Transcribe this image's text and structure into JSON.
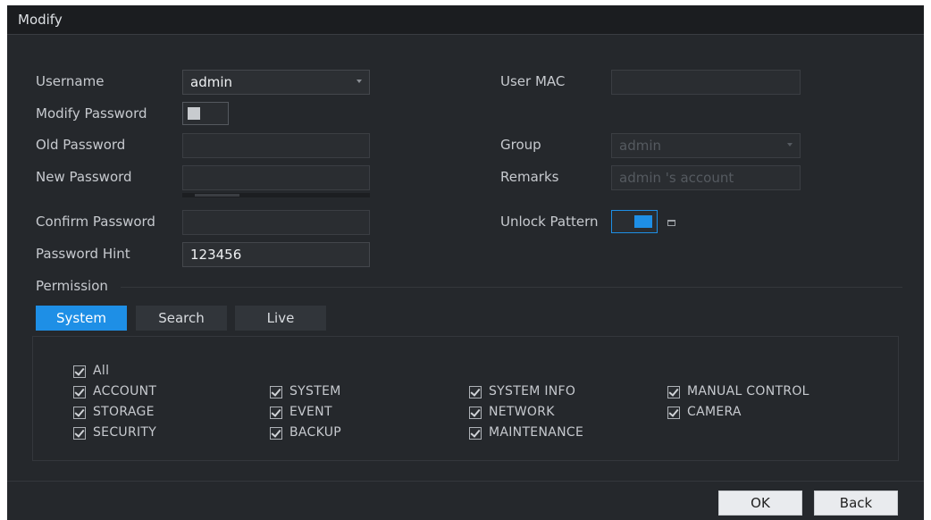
{
  "dialog": {
    "title": "Modify"
  },
  "form": {
    "username": {
      "label": "Username",
      "value": "admin"
    },
    "modify_password": {
      "label": "Modify Password",
      "on": false
    },
    "old_password": {
      "label": "Old Password",
      "value": ""
    },
    "new_password": {
      "label": "New Password",
      "value": ""
    },
    "confirm_password": {
      "label": "Confirm Password",
      "value": ""
    },
    "password_hint": {
      "label": "Password Hint",
      "value": "123456"
    },
    "user_mac": {
      "label": "User MAC",
      "value": ""
    },
    "group": {
      "label": "Group",
      "value": "admin"
    },
    "remarks": {
      "label": "Remarks",
      "value": "admin 's account"
    },
    "unlock_pattern": {
      "label": "Unlock Pattern",
      "on": true
    }
  },
  "permission": {
    "label": "Permission",
    "tabs": [
      {
        "label": "System",
        "active": true
      },
      {
        "label": "Search",
        "active": false
      },
      {
        "label": "Live",
        "active": false
      }
    ],
    "all": {
      "label": "All",
      "checked": true
    },
    "columns": [
      [
        "ACCOUNT",
        "STORAGE",
        "SECURITY"
      ],
      [
        "SYSTEM",
        "EVENT",
        "BACKUP"
      ],
      [
        "SYSTEM INFO",
        "NETWORK",
        "MAINTENANCE"
      ],
      [
        "MANUAL CONTROL",
        "CAMERA"
      ]
    ]
  },
  "buttons": {
    "ok": "OK",
    "back": "Back"
  },
  "colors": {
    "accent": "#1e8fe6",
    "background": "#25282c",
    "titlebar": "#1b1d20"
  }
}
